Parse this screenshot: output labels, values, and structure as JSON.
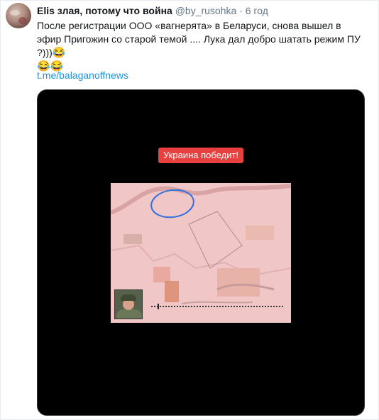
{
  "tweet": {
    "author": "Elis злая, потому что война",
    "handle": "@by_rusohka",
    "separator": "·",
    "time": "6 год",
    "text": "После регистрации ООО «вагнерята» в Беларуси, снова вышел в эфир Пригожин со старой темой .... Лука дал добро шатать режим ПУ ?)))",
    "emoji_a": "😂",
    "emoji_b": "😂😂",
    "link": "t.me/balaganoffnews"
  },
  "media": {
    "banner": "Украина победит!"
  }
}
